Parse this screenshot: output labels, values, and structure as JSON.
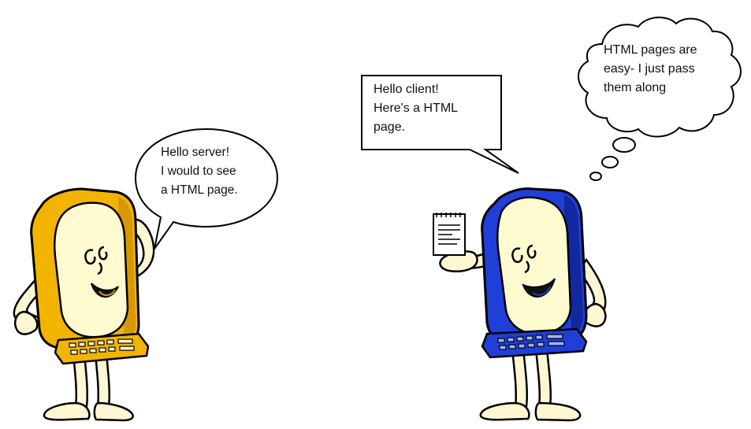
{
  "colors": {
    "client_body": "#f3b400",
    "client_dark": "#d89800",
    "server_body": "#1f3fd8",
    "server_dark": "#1128a0",
    "screen": "#fffbd0",
    "skin": "#fff6d2",
    "outline": "#000000",
    "background": "#ffffff"
  },
  "characters": {
    "client": {
      "role": "client",
      "icon": "yellow-computer-character"
    },
    "server": {
      "role": "server",
      "icon": "blue-computer-character"
    }
  },
  "bubbles": {
    "client_speech": {
      "lines": [
        "Hello server!",
        "I would to see",
        "a HTML page."
      ]
    },
    "server_speech": {
      "lines": [
        "Hello client!",
        "Here's a HTML",
        "page."
      ]
    },
    "server_thought": {
      "lines": [
        "HTML pages are",
        "easy- I just pass",
        "them along"
      ]
    }
  },
  "props": {
    "document_icon": "notepad-page-icon"
  }
}
